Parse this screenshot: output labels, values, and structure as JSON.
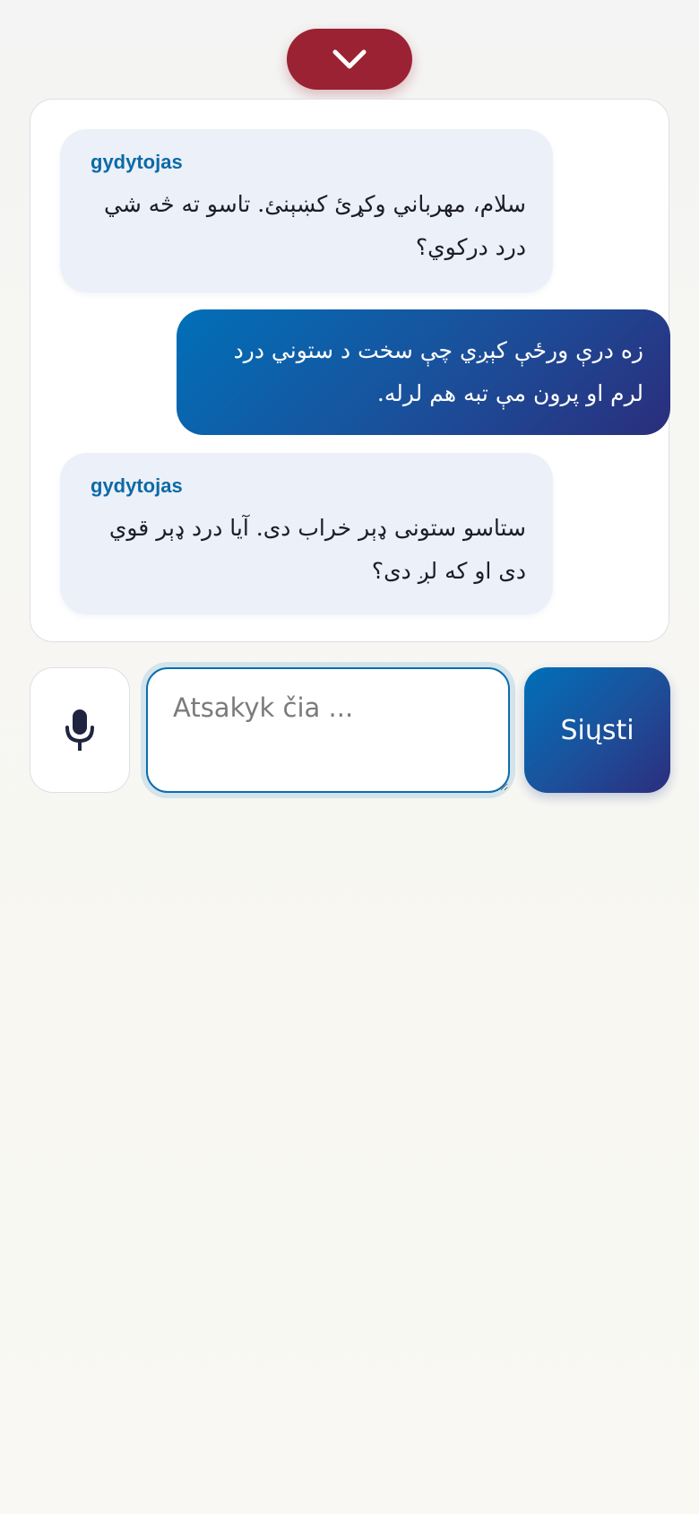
{
  "header": {
    "collapse_icon": "chevron-down-icon",
    "accent_color": "#9b2233"
  },
  "chat": {
    "messages": [
      {
        "role": "doctor",
        "sender": "gydytojas",
        "text": "سلام، مهرباني وکړئ کښېنئ. تاسو ته څه شي درد درکوي؟"
      },
      {
        "role": "patient",
        "text": "زه درې ورځې کېږي چې سخت د ستوني درد لرم او پرون مې تبه هم لرله."
      },
      {
        "role": "doctor",
        "sender": "gydytojas",
        "text": "ستاسو ستونی ډېر خراب دی. آیا درد ډېر قوي دی او که لږ دی؟"
      }
    ]
  },
  "composer": {
    "mic_icon": "microphone-icon",
    "placeholder": "Atsakyk čia ...",
    "value": "",
    "send_label": "Siųsti"
  },
  "colors": {
    "doctor_bubble": "#ecf0f8",
    "sender_label": "#0c6aa6",
    "patient_bubble_start": "#0070b8",
    "patient_bubble_end": "#2a2e7c"
  }
}
